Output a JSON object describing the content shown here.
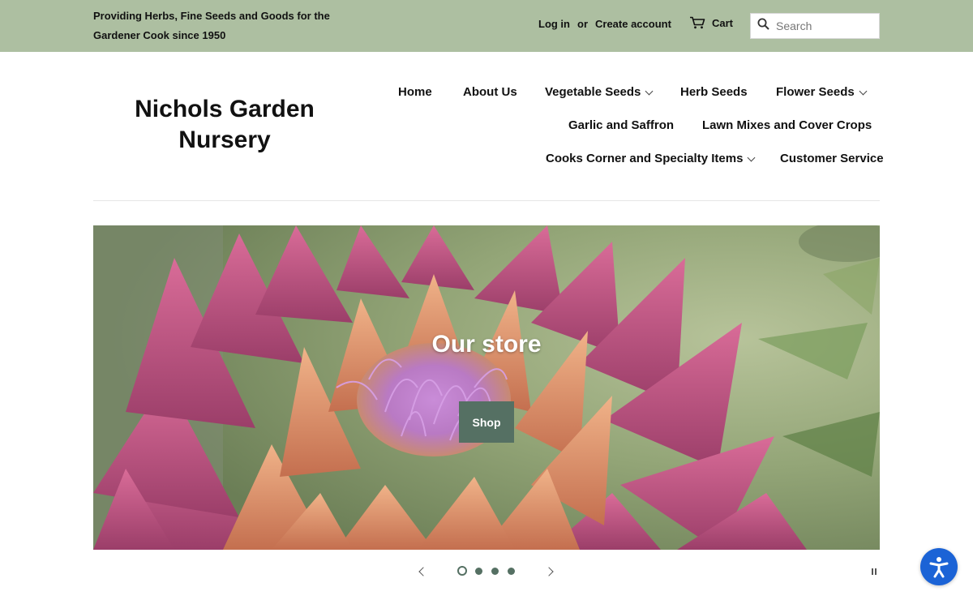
{
  "announcement": {
    "tagline": "Providing Herbs, Fine Seeds and Goods for the Gardener Cook since 1950",
    "login_label": "Log in",
    "or_label": "or",
    "create_account_label": "Create account",
    "cart_label": "Cart",
    "search_placeholder": "Search",
    "background_color": "#adbfa1"
  },
  "header": {
    "logo_line1": "Nichols Garden",
    "logo_line2": "Nursery"
  },
  "nav": {
    "items": [
      {
        "label": "Home",
        "has_dropdown": false
      },
      {
        "label": "About Us",
        "has_dropdown": false
      },
      {
        "label": "Vegetable Seeds",
        "has_dropdown": true
      },
      {
        "label": "Herb Seeds",
        "has_dropdown": false
      },
      {
        "label": "Flower Seeds",
        "has_dropdown": true
      },
      {
        "label": "Garlic and Saffron",
        "has_dropdown": false
      },
      {
        "label": "Lawn Mixes and Cover Crops",
        "has_dropdown": false
      },
      {
        "label": "Cooks Corner and Specialty Items",
        "has_dropdown": true
      },
      {
        "label": "Customer Service",
        "has_dropdown": false
      }
    ]
  },
  "hero": {
    "title": "Our store",
    "button_label": "Shop",
    "button_color": "#557063",
    "slide_count": 4,
    "active_slide": 1
  },
  "icons": {
    "cart": "cart-icon",
    "search": "search-icon",
    "accessibility": "accessibility-icon",
    "prev": "chevron-left-icon",
    "next": "chevron-right-icon",
    "pause": "pause-icon"
  },
  "colors": {
    "accent": "#557063",
    "accessibility_button": "#1b63d6"
  }
}
